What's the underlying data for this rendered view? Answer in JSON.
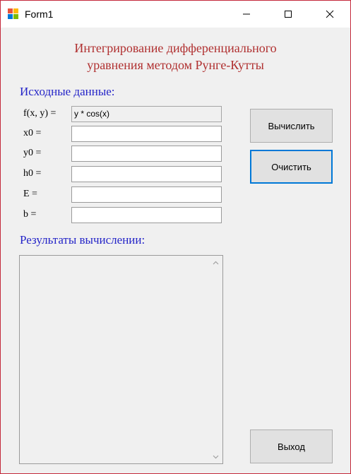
{
  "window": {
    "title": "Form1",
    "controls": {
      "minimize": "minimize-icon",
      "maximize": "maximize-icon",
      "close": "close-icon"
    }
  },
  "heading": {
    "line1": "Интегрирование дифференциального",
    "line2": "уравнения методом Рунге-Кутты"
  },
  "input_section": {
    "label": "Исходные данные:",
    "fields": [
      {
        "label": "f(x, y) =",
        "value": "y * cos(x)"
      },
      {
        "label": "x0 =",
        "value": ""
      },
      {
        "label": "y0 =",
        "value": ""
      },
      {
        "label": "h0 =",
        "value": ""
      },
      {
        "label": "E =",
        "value": ""
      },
      {
        "label": "b =",
        "value": ""
      }
    ]
  },
  "buttons": {
    "calculate": "Вычислить",
    "clear": "Очистить",
    "exit": "Выход"
  },
  "results_section": {
    "label": "Результаты вычислении:",
    "value": ""
  },
  "colors": {
    "heading": "#b03030",
    "section_label": "#2525c8",
    "window_border": "#c4293b",
    "focus_border": "#0078d7"
  }
}
